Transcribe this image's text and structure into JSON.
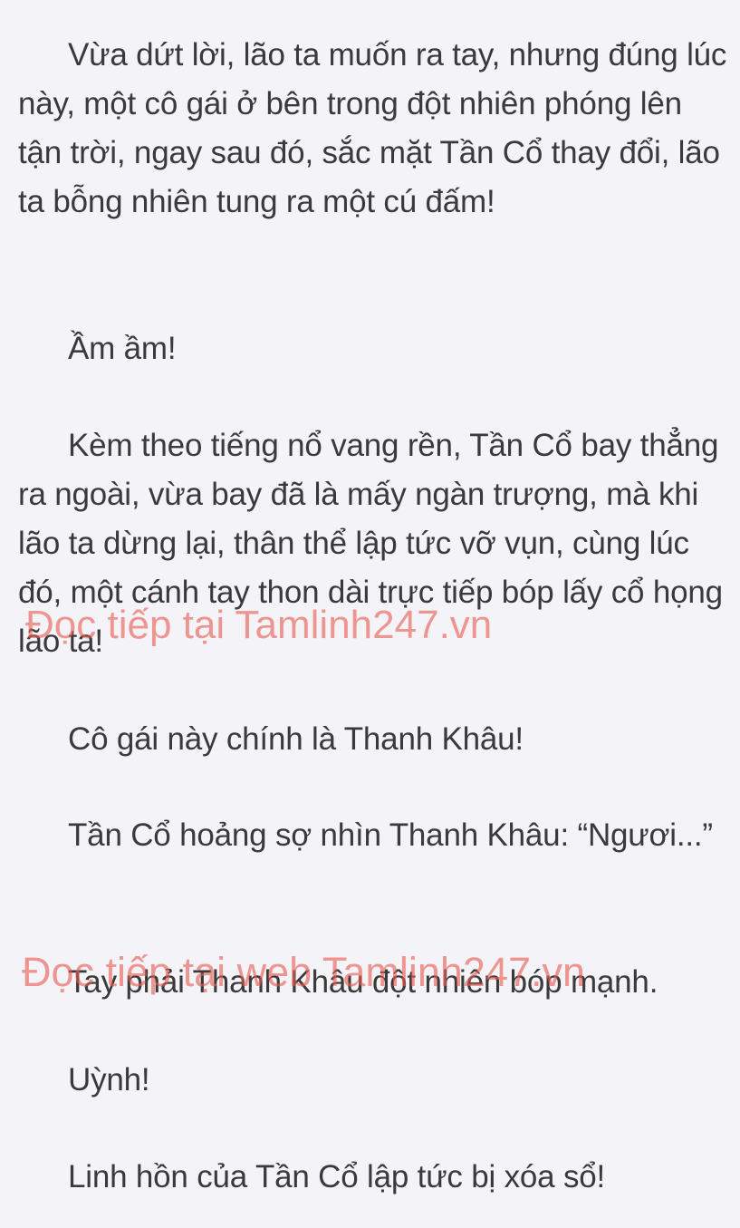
{
  "paragraphs": [
    "Vừa dứt lời, lão ta muốn ra tay, nhưng đúng lúc này, một cô gái ở bên trong đột nhiên phóng lên tận trời, ngay sau đó, sắc mặt Tần Cổ thay đổi, lão ta bỗng nhiên tung ra một cú đấm!",
    "Ầm ầm!",
    "Kèm theo tiếng nổ vang rền, Tần Cổ bay thẳng ra ngoài, vừa bay đã là mấy ngàn trượng, mà khi lão ta dừng lại, thân thể lập tức vỡ vụn, cùng lúc đó, một cánh tay thon dài trực tiếp bóp lấy cổ họng lão ta!",
    "Cô gái này chính là Thanh Khâu!",
    "Tần Cổ hoảng sợ nhìn Thanh Khâu: “Ngươi...”",
    "Tay phải Thanh Khâu đột nhiên bóp mạnh.",
    "Uỳnh!",
    "Linh hồn của Tần Cổ lập tức bị xóa sổ!"
  ],
  "watermarks": [
    "Đọc tiếp tại Tamlinh247.vn",
    "Đọc tiếp tại web Tamlinh247.vn"
  ],
  "colors": {
    "background": "#f4f4f8",
    "text": "#3a3a3a",
    "watermark": "#e85a50"
  }
}
